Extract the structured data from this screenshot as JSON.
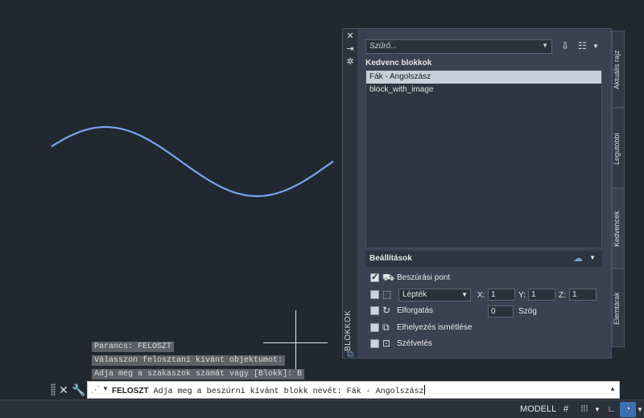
{
  "command_history": [
    "Parancs: FELOSZT",
    "Válasszon felosztani kívánt objektumot:",
    "Adja meg a szakaszok számát vagy [Blokk]: B"
  ],
  "command_line": {
    "command": "FELOSZT",
    "prompt": "Adja meg a beszúrni kívánt blokk nevét: Fák - Angolszász"
  },
  "status_bar": {
    "model": "MODELL"
  },
  "palette": {
    "title": "BLOKKOK",
    "filter_placeholder": "Szűrő...",
    "favorites_title": "Kedvenc blokkok",
    "favorites": [
      "Fák - Angolszász",
      "block_with_image"
    ],
    "selected_index": 0,
    "settings": {
      "title": "Beállítások",
      "insertion_point": {
        "label": "Beszúrási pont",
        "checked": true
      },
      "scale": {
        "value": "Lépték",
        "checked": false,
        "x_label": "X:",
        "x": "1",
        "y_label": "Y:",
        "y": "1",
        "z_label": "Z:",
        "z": "1"
      },
      "rotation": {
        "label": "Elforgatás",
        "checked": false,
        "value": "0",
        "unit": "Szög"
      },
      "repeat": {
        "label": "Elhelyezés ismétlése",
        "checked": false
      },
      "explode": {
        "label": "Szétvetés",
        "checked": false
      }
    }
  },
  "side_tabs": [
    "Aktuális rajz",
    "Legutóbbi",
    "Kedvencek",
    "Elemtárak"
  ],
  "active_tab": "Kedvencek",
  "colors": {
    "background": "#212830",
    "spline": "#7aa3f0",
    "selection": "#c8cfda",
    "accent": "#3a6fb0"
  },
  "icons": [
    "close-icon",
    "pin-icon",
    "gear-icon",
    "wrench-icon",
    "grid-icon",
    "snap-icon",
    "ortho-icon",
    "polar-icon",
    "cloud-sync-icon",
    "list-view-icon",
    "insert-block-icon"
  ]
}
